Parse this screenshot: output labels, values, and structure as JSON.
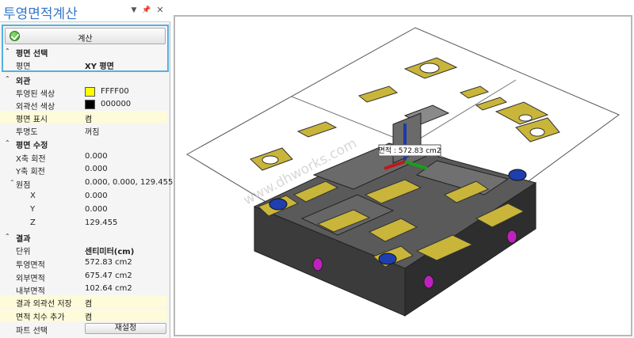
{
  "panel": {
    "title": "투영면적계산",
    "calc_button": "계산",
    "sections": {
      "plane_select": "평면 선택",
      "appearance": "외관",
      "plane_edit": "평면 수정",
      "result": "결과"
    },
    "rows": {
      "plane": {
        "label": "평면",
        "value": "XY 평면"
      },
      "proj_color": {
        "label": "투영된 색상",
        "value": "FFFF00",
        "color": "#ffff00"
      },
      "outline_color": {
        "label": "외곽선 색상",
        "value": "000000",
        "color": "#000000"
      },
      "plane_display": {
        "label": "평면 표시",
        "value": "켬"
      },
      "transparency": {
        "label": "투명도",
        "value": "꺼짐"
      },
      "x_rot": {
        "label": "X축 회전",
        "value": "0.000"
      },
      "y_rot": {
        "label": "Y축 회전",
        "value": "0.000"
      },
      "origin": {
        "label": "원점",
        "value": "0.000, 0.000, 129.455"
      },
      "ox": {
        "label": "X",
        "value": "0.000"
      },
      "oy": {
        "label": "Y",
        "value": "0.000"
      },
      "oz": {
        "label": "Z",
        "value": "129.455"
      },
      "unit": {
        "label": "단위",
        "value": "센티미터(cm)"
      },
      "proj_area": {
        "label": "투영면적",
        "value": "572.83 cm2"
      },
      "outer_area": {
        "label": "외부면적",
        "value": "675.47 cm2"
      },
      "inner_area": {
        "label": "내부면적",
        "value": "102.64 cm2"
      },
      "save_outline": {
        "label": "결과 외곽선 저장",
        "value": "켬"
      },
      "add_dimension": {
        "label": "면적 치수 추가",
        "value": "켬"
      },
      "part_select": {
        "label": "파트 선택",
        "value": "재설정"
      }
    }
  },
  "viewport": {
    "area_label": "면적 : 572.83 cm2",
    "watermark": "www.dhworks.com"
  },
  "colors": {
    "accent": "#3476c9",
    "highlight": "#58aee0",
    "plate": "#c8b43c",
    "body": "#4a4a4a"
  }
}
